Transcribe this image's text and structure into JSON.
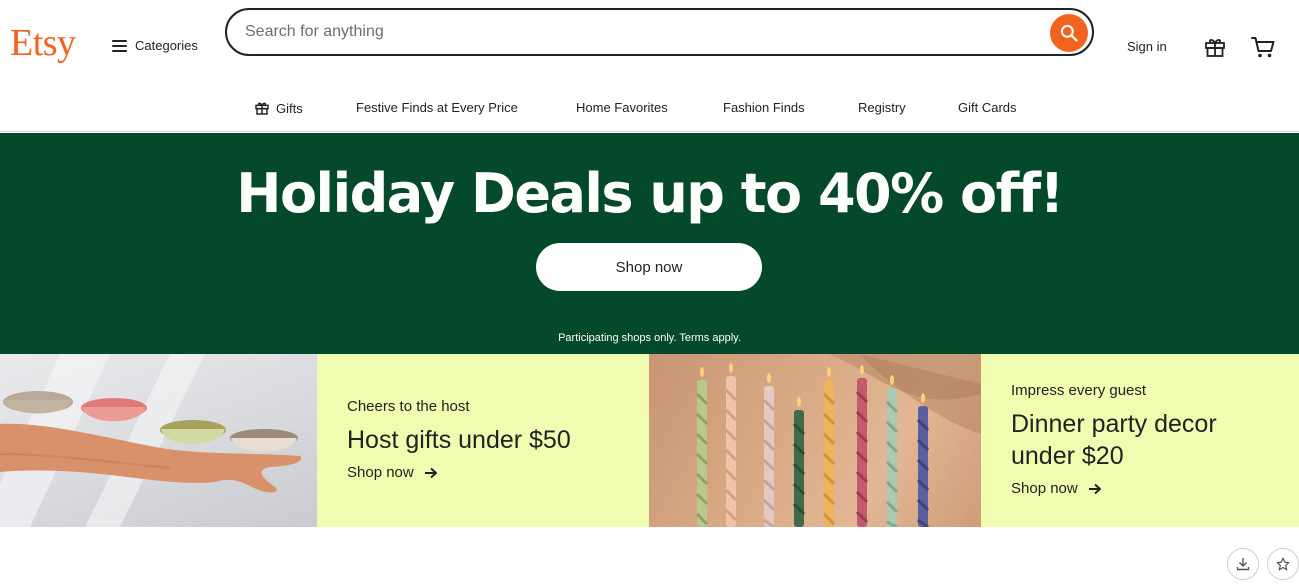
{
  "header": {
    "logo": "Etsy",
    "categories_label": "Categories",
    "search_placeholder": "Search for anything",
    "signin_label": "Sign in"
  },
  "nav": {
    "items": [
      "Gifts",
      "Festive Finds at Every Price",
      "Home Favorites",
      "Fashion Finds",
      "Registry",
      "Gift Cards"
    ]
  },
  "hero": {
    "title": "Holiday Deals up to 40% off!",
    "button_label": "Shop now",
    "fine_print": "Participating shops only. Terms apply."
  },
  "promos": [
    {
      "kicker": "Cheers to the host",
      "headline_line1": "Host gifts under $50",
      "headline_line2": "",
      "link_label": "Shop now"
    },
    {
      "kicker": "Impress every guest",
      "headline_line1": "Dinner party decor",
      "headline_line2": "under $20",
      "link_label": "Shop now"
    }
  ],
  "icons": [
    "hamburger-icon",
    "search-icon",
    "gift-icon",
    "cart-icon",
    "arrow-right-icon",
    "download-icon",
    "star-icon"
  ],
  "colors": {
    "brand_orange": "#f1641e",
    "hero_green": "#04492a",
    "promo_yellow": "#f0fcb0",
    "text": "#222222"
  }
}
